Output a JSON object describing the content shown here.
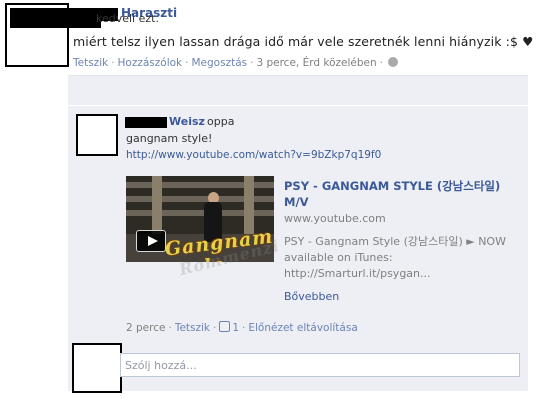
{
  "post": {
    "author_suffix": "Haraszti",
    "text": "miért telsz  ilyen lassan drága idő már vele szeretnék lenni hiányzik :$ ♥",
    "actions": {
      "like": "Tetszik",
      "comment": "Hozzászólok",
      "share": "Megosztás",
      "meta": "3 perce, Érd közelében",
      "privacy_icon": "globe-icon"
    }
  },
  "likes": {
    "text": "kedveli ezt."
  },
  "comment": {
    "author_suffix": "Weisz",
    "author_extra": "oppa",
    "text": "gangnam style!",
    "link": "http://www.youtube.com/watch?v=9bZkp7q19f0",
    "share": {
      "thumbnail_text": "Gangnam Style",
      "title": "PSY - GANGNAM STYLE (강남스타일) M/V",
      "domain": "www.youtube.com",
      "description_line1": "PSY - Gangnam Style (강남스타일) ► NOW",
      "description_line2": "available on iTunes:",
      "description_line3": "http://Smarturl.it/psygan...",
      "more": "Bővebben"
    },
    "watermark": "Rommenzi",
    "actions": {
      "time": "2 perce",
      "like": "Tetszik",
      "like_count": "1",
      "remove_preview": "Előnézet eltávolítása"
    }
  },
  "reply": {
    "placeholder": "Szólj hozzá..."
  },
  "colors": {
    "link": "#3b5998",
    "feedback_bg": "#edeff4",
    "meta_text": "#7f7f7f"
  }
}
